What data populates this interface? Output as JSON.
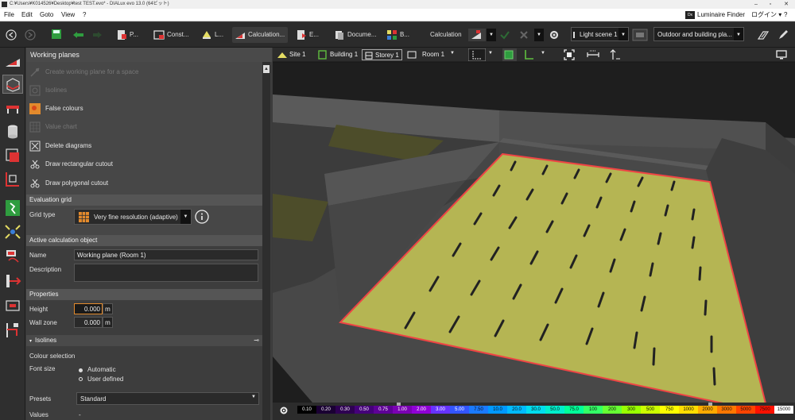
{
  "titlebar": {
    "title": "C:¥Users¥K014526¥Desktop¥test TEST.evo* - DIALux evo 13.0 (64ビット)"
  },
  "menu": [
    "File",
    "Edit",
    "Goto",
    "View",
    "?"
  ],
  "account": {
    "luminaire_finder": "Luminaire Finder",
    "login": "ログイン",
    "help": "?"
  },
  "toolbar": {
    "tabs": [
      "P...",
      "Const...",
      "L...",
      "Calculation...",
      "E...",
      "Docume...",
      "B..."
    ],
    "calculation_label": "Calculation",
    "light_scene": "Light scene 1",
    "view_mode": "Outdoor and building pla..."
  },
  "panel": {
    "title": "Working planes",
    "actions": [
      {
        "label": "Create working plane for a space",
        "enabled": false
      },
      {
        "label": "Isolines",
        "enabled": false
      },
      {
        "label": "False colours",
        "enabled": true
      },
      {
        "label": "Value chart",
        "enabled": false
      },
      {
        "label": "Delete diagrams",
        "enabled": true
      },
      {
        "label": "Draw rectangular cutout",
        "enabled": true
      },
      {
        "label": "Draw polygonal cutout",
        "enabled": true
      }
    ],
    "evaluation_grid": {
      "header": "Evaluation grid",
      "grid_type_label": "Grid type",
      "grid_type_value": "Very fine resolution (adaptive)"
    },
    "active_object": {
      "header": "Active calculation object",
      "name_label": "Name",
      "name_value": "Working plane (Room 1)",
      "description_label": "Description",
      "description_value": ""
    },
    "properties": {
      "header": "Properties",
      "height_label": "Height",
      "height_value": "0.000",
      "height_unit": "m",
      "wall_zone_label": "Wall zone",
      "wall_zone_value": "0.000",
      "wall_zone_unit": "m"
    },
    "isolines": {
      "header": "Isolines",
      "colour_selection": "Colour selection",
      "font_size_label": "Font size",
      "font_automatic": "Automatic",
      "font_user": "User defined",
      "presets_label": "Presets",
      "presets_value": "Standard",
      "values_label": "Values",
      "values_value": "-"
    }
  },
  "viewport": {
    "breadcrumbs": [
      "Site 1",
      "Building 1",
      "Storey 1",
      "Room 1"
    ],
    "scale": [
      "0.10",
      "0.20",
      "0.30",
      "0.50",
      "0.75",
      "1.00",
      "2.00",
      "3.00",
      "5.00",
      "7.50",
      "10.0",
      "20.0",
      "30.0",
      "50.0",
      "75.0",
      "100",
      "200",
      "300",
      "500",
      "750",
      "1000",
      "2000",
      "3000",
      "5000",
      "7500",
      "15000"
    ],
    "scale_colors": [
      "#000000",
      "#1a0033",
      "#2e0052",
      "#45007a",
      "#5e0096",
      "#7a00b3",
      "#8f00d6",
      "#6633ff",
      "#3355ff",
      "#1a7aff",
      "#0099ff",
      "#00bbff",
      "#00ddee",
      "#00eecc",
      "#00ff99",
      "#33ff66",
      "#66ff33",
      "#99ff00",
      "#ccff00",
      "#ffff00",
      "#ffdd00",
      "#ffaa00",
      "#ff7700",
      "#ff4400",
      "#ff1100",
      "#ffffff"
    ]
  }
}
